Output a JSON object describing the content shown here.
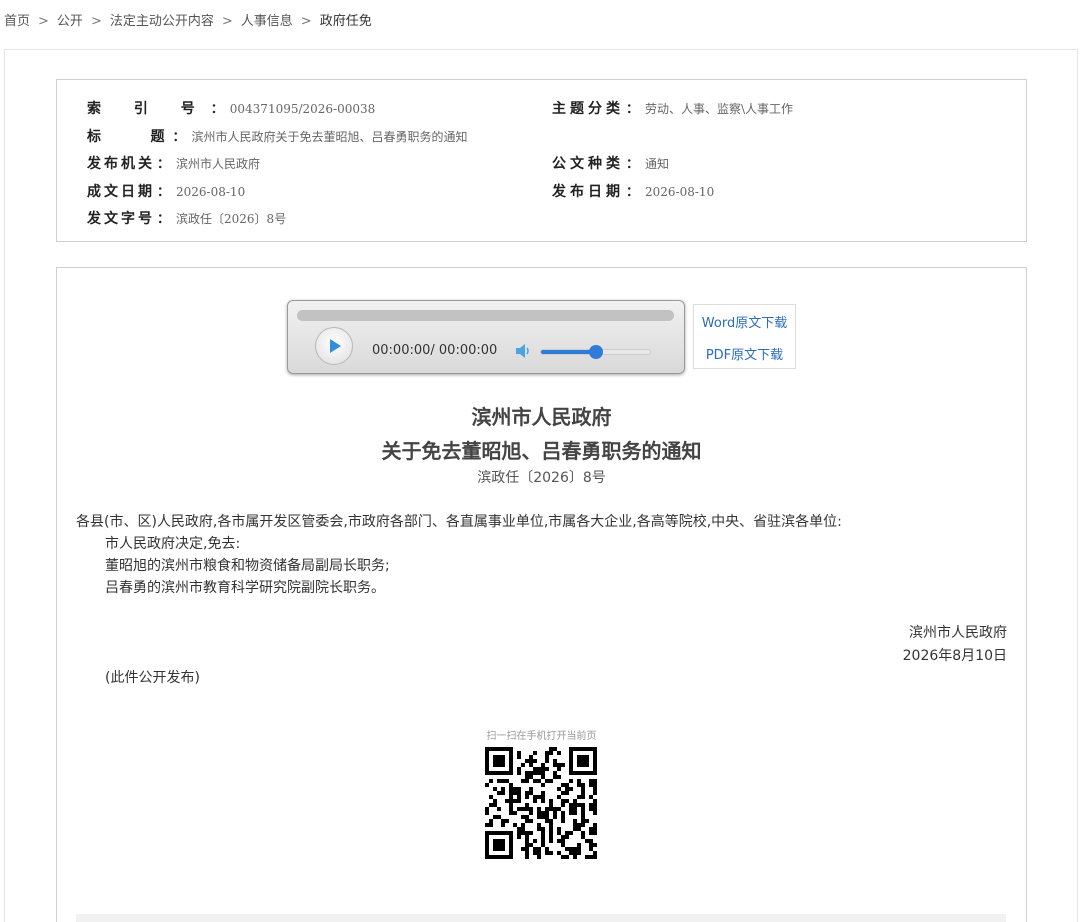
{
  "breadcrumb": {
    "items": [
      "首页",
      "公开",
      "法定主动公开内容",
      "人事信息"
    ],
    "current": "政府任免",
    "separator": ">"
  },
  "meta": {
    "index_label": "索 引 号",
    "index_value": "004371095/2026-00038",
    "topic_label": "主题分类",
    "topic_value": "劳动、人事、监察\\人事工作",
    "title_label": "标    题",
    "title_value": "滨州市人民政府关于免去董昭旭、吕春勇职务的通知",
    "issuer_label": "发布机关",
    "issuer_value": "滨州市人民政府",
    "doctype_label": "公文种类",
    "doctype_value": "通知",
    "written_label": "成文日期",
    "written_value": "2026-08-10",
    "published_label": "发布日期",
    "published_value": "2026-08-10",
    "docno_label": "发文字号",
    "docno_value": "滨政任〔2026〕8号",
    "colon": "："
  },
  "player": {
    "time": "00:00:00/ 00:00:00",
    "progress": 0,
    "volume": 0.5,
    "accent": "#2f7bd9"
  },
  "downloads": {
    "word": "Word原文下载",
    "pdf": "PDF原文下载"
  },
  "document": {
    "title_line1": "滨州市人民政府",
    "title_line2": "关于免去董昭旭、吕春勇职务的通知",
    "number": "滨政任〔2026〕8号",
    "salutation": "各县(市、区)人民政府,各市属开发区管委会,市政府各部门、各直属事业单位,市属各大企业,各高等院校,中央、省驻滨各单位:",
    "p1": "市人民政府决定,免去:",
    "p2": "董昭旭的滨州市粮食和物资储备局副局长职务;",
    "p3": "吕春勇的滨州市教育科学研究院副院长职务。",
    "signature_org": "滨州市人民政府",
    "signature_date": "2026年8月10日",
    "note": "(此件公开发布)"
  },
  "qr": {
    "label": "扫一扫在手机打开当前页"
  }
}
